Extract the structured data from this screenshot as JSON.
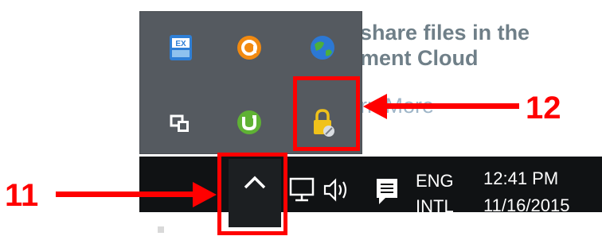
{
  "background_page": {
    "line1": "share files in the",
    "line2": "ment Cloud",
    "line3": "rn More"
  },
  "tray_popup": {
    "icons": [
      {
        "name": "exchange-app-icon",
        "color": "#2f7fd6"
      },
      {
        "name": "avast-icon",
        "color": "#f28a10"
      },
      {
        "name": "globe-icon",
        "color": "#2c78d4"
      },
      {
        "name": "windows-mobility-icon",
        "color": "#ffffff"
      },
      {
        "name": "utorrent-icon",
        "color": "#5fb234"
      },
      {
        "name": "lock-vpn-icon",
        "color": "#f0c21a"
      }
    ]
  },
  "taskbar": {
    "language_line1": "ENG",
    "language_line2": "INTL",
    "time": "12:41 PM",
    "date": "11/16/2015"
  },
  "annotations": {
    "callout_11": "11",
    "callout_12": "12",
    "accent_color": "#ff0000"
  }
}
